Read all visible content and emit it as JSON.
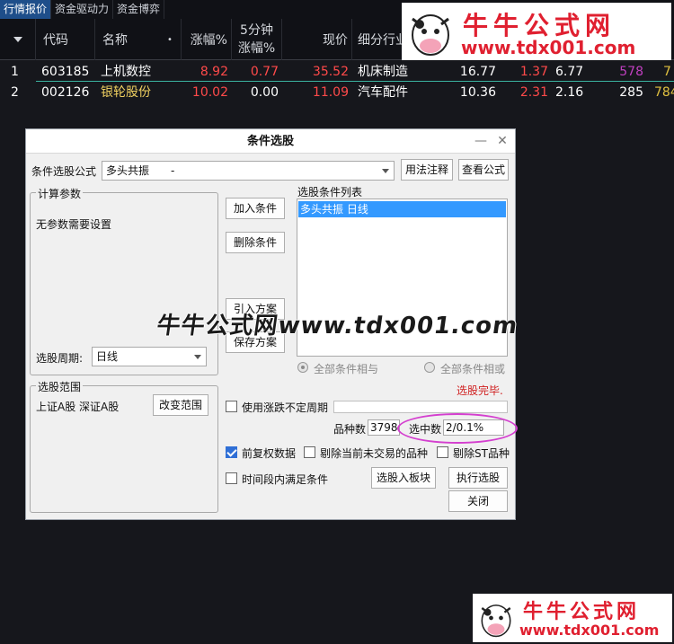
{
  "tabs": [
    "行情报价",
    "资金驱动力",
    "资金博弈"
  ],
  "header": {
    "code": "代码",
    "name": "名称",
    "dot": "•",
    "change": "涨幅%",
    "change5_line1": "5分钟",
    "change5_line2": "涨幅%",
    "price": "现价",
    "industry": "细分行业"
  },
  "rows": [
    {
      "idx": "1",
      "code": "603185",
      "name": "上机数控",
      "change": "8.92",
      "change5": "0.77",
      "price": "35.52",
      "industry": "机床制造",
      "c6": "16.77",
      "c7": "1.37",
      "c8": "6.77",
      "c9": "578",
      "c10": "7"
    },
    {
      "idx": "2",
      "code": "002126",
      "name": "银轮股份",
      "change": "10.02",
      "change5": "0.00",
      "price": "11.09",
      "industry": "汽车配件",
      "c6": "10.36",
      "c7": "2.31",
      "c8": "2.16",
      "c9": "285",
      "c10": "784"
    }
  ],
  "logo": {
    "title": "牛牛公式网",
    "url": "www.tdx001.com"
  },
  "watermark": "牛牛公式网www.tdx001.com",
  "dialog": {
    "title": "条件选股",
    "minimize": "—",
    "close": "✕",
    "formula_label": "条件选股公式",
    "formula_value": "多头共振　　-",
    "usage_btn": "用法注释",
    "view_btn": "查看公式",
    "params_group": "计算参数",
    "params_text": "无参数需要设置",
    "period_label": "选股周期:",
    "period_value": "日线",
    "add_btn": "加入条件",
    "del_btn": "删除条件",
    "import_btn": "引入方案",
    "save_btn": "保存方案",
    "list_group": "选股条件列表",
    "list_item": "多头共振  日线",
    "radio_and": "全部条件相与",
    "radio_or": "全部条件相或",
    "status": "选股完毕.",
    "range_group": "选股范围",
    "range_text": "上证A股 深证A股",
    "range_btn": "改变范围",
    "use_period": "使用涨跌不定周期",
    "count_label": "品种数",
    "count_value": "3798",
    "selected_label": "选中数",
    "selected_value": "2/0.1%",
    "prev_adj": "前复权数据",
    "exclude_notrade": "剔除当前未交易的品种",
    "exclude_st": "剔除ST品种",
    "period_cond": "时间段内满足条件",
    "to_block_btn": "选股入板块",
    "exec_btn": "执行选股",
    "close_btn": "关闭"
  },
  "colors": {
    "up": "#ff4a4a",
    "purple": "#c040c0",
    "highlight_ring": "#d43fcf",
    "accent_blue": "#2f6fd6"
  }
}
